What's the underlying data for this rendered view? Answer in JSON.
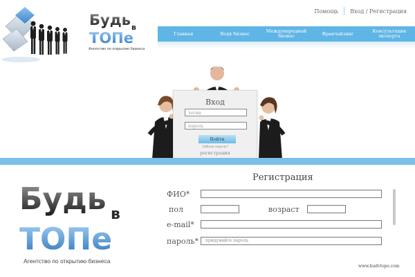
{
  "header": {
    "logo_line1": "Будь",
    "logo_small": "в",
    "logo_line2": "ТОПе",
    "logo_tagline": "Агентство по открытию бизнеса",
    "toplinks": {
      "help": "Помощь",
      "login_register": "Вход / Регистрация"
    }
  },
  "nav": {
    "items": [
      {
        "label": "Главная"
      },
      {
        "label": "Ведя бизнес"
      },
      {
        "label": "Международный бизнес"
      },
      {
        "label": "Франчайзинг"
      },
      {
        "label": "Консультации эксперта"
      }
    ]
  },
  "login": {
    "title": "Вход",
    "login_placeholder": "логин",
    "password_placeholder": "пароль",
    "submit_label": "Войти",
    "forgot_label": "Забыли пароль?",
    "register_link": "регистрация"
  },
  "big_logo": {
    "line1": "Будь",
    "small": "в",
    "line2": "ТОПе",
    "tagline": "Агентство по открытию бизнеса"
  },
  "registration": {
    "title": "Регистрация",
    "fio_label": "ФИО*",
    "gender_label": "пол",
    "age_label": "возраст",
    "email_label": "e-mail*",
    "password_label": "пароль*",
    "password_placeholder": "придумайте пароль"
  },
  "footer": {
    "url": "www.budvtope.com"
  },
  "colors": {
    "accent": "#5fb5e5",
    "band": "#7bbfe8",
    "logo_dark": "#2b2b2b",
    "logo_blue": "#3f8fd0"
  }
}
